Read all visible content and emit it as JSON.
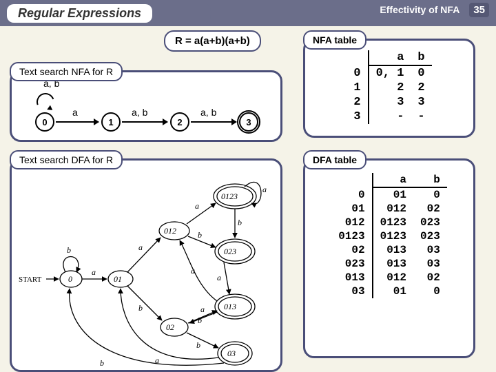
{
  "header": {
    "title": "Regular Expressions",
    "subtitle": "Effectivity of NFA",
    "page": "35"
  },
  "formula": "R = a(a+b)(a+b)",
  "nfa": {
    "label": "Text search NFA for R",
    "loop_label": "a, b",
    "edge01": "a",
    "edge12": "a, b",
    "edge23": "a, b",
    "s0": "0",
    "s1": "1",
    "s2": "2",
    "s3": "3"
  },
  "dfa": {
    "label": "Text search DFA for R",
    "start": "START"
  },
  "nfa_table": {
    "label": "NFA table",
    "head": [
      "",
      "a",
      "b"
    ],
    "rows": [
      [
        "0",
        "0, 1",
        "0"
      ],
      [
        "1",
        "2",
        "2"
      ],
      [
        "2",
        "3",
        "3"
      ],
      [
        "3",
        "-",
        "-"
      ]
    ]
  },
  "dfa_table": {
    "label": "DFA table",
    "head": [
      "",
      "a",
      "b"
    ],
    "rows": [
      [
        "0",
        "01",
        "0"
      ],
      [
        "01",
        "012",
        "02"
      ],
      [
        "012",
        "0123",
        "023"
      ],
      [
        "0123",
        "0123",
        "023"
      ],
      [
        "02",
        "013",
        "03"
      ],
      [
        "023",
        "013",
        "03"
      ],
      [
        "013",
        "012",
        "02"
      ],
      [
        "03",
        "01",
        "0"
      ]
    ]
  },
  "dfa_nodes": [
    "0",
    "01",
    "012",
    "0123",
    "02",
    "023",
    "013",
    "03"
  ],
  "chart_data": {
    "type": "diagram",
    "title": "Text search NFA / DFA for R = a(a+b)(a+b)",
    "nfa": {
      "states": [
        "0",
        "1",
        "2",
        "3"
      ],
      "start": "0",
      "final": [
        "3"
      ],
      "transitions": [
        {
          "from": "0",
          "to": "0",
          "label": "a,b"
        },
        {
          "from": "0",
          "to": "1",
          "label": "a"
        },
        {
          "from": "1",
          "to": "2",
          "label": "a,b"
        },
        {
          "from": "2",
          "to": "3",
          "label": "a,b"
        }
      ]
    },
    "dfa": {
      "states": [
        "0",
        "01",
        "012",
        "0123",
        "02",
        "023",
        "013",
        "03"
      ],
      "start": "0",
      "final": [
        "0123",
        "023",
        "013",
        "03"
      ],
      "transitions": [
        {
          "from": "0",
          "a": "01",
          "b": "0"
        },
        {
          "from": "01",
          "a": "012",
          "b": "02"
        },
        {
          "from": "012",
          "a": "0123",
          "b": "023"
        },
        {
          "from": "0123",
          "a": "0123",
          "b": "023"
        },
        {
          "from": "02",
          "a": "013",
          "b": "03"
        },
        {
          "from": "023",
          "a": "013",
          "b": "03"
        },
        {
          "from": "013",
          "a": "012",
          "b": "02"
        },
        {
          "from": "03",
          "a": "01",
          "b": "0"
        }
      ]
    }
  }
}
